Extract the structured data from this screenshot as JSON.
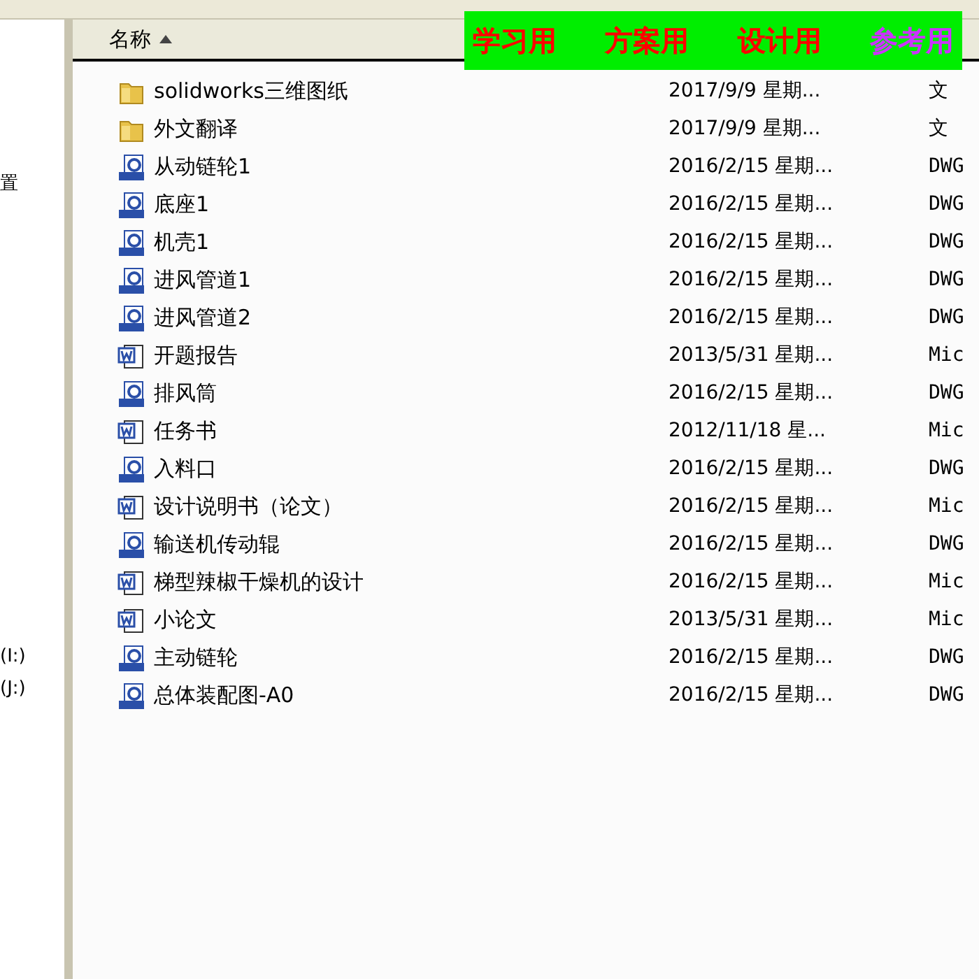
{
  "sidebar": {
    "items": [
      {
        "label": "置"
      },
      {
        "label": "(I:)"
      },
      {
        "label": "(J:)"
      }
    ]
  },
  "table": {
    "columns": [
      {
        "label": "名称",
        "sorted": true
      }
    ],
    "rows": [
      {
        "kind": "folder",
        "name": "solidworks三维图纸",
        "date": "2017/9/9 星期...",
        "type": "文"
      },
      {
        "kind": "folder",
        "name": "外文翻译",
        "date": "2017/9/9 星期...",
        "type": "文"
      },
      {
        "kind": "dwg",
        "name": "从动链轮1",
        "date": "2016/2/15 星期...",
        "type": "DWG"
      },
      {
        "kind": "dwg",
        "name": "底座1",
        "date": "2016/2/15 星期...",
        "type": "DWG"
      },
      {
        "kind": "dwg",
        "name": "机壳1",
        "date": "2016/2/15 星期...",
        "type": "DWG"
      },
      {
        "kind": "dwg",
        "name": "进风管道1",
        "date": "2016/2/15 星期...",
        "type": "DWG"
      },
      {
        "kind": "dwg",
        "name": "进风管道2",
        "date": "2016/2/15 星期...",
        "type": "DWG"
      },
      {
        "kind": "doc",
        "name": "开题报告",
        "date": "2013/5/31 星期...",
        "type": "Mic"
      },
      {
        "kind": "dwg",
        "name": "排风筒",
        "date": "2016/2/15 星期...",
        "type": "DWG"
      },
      {
        "kind": "doc",
        "name": "任务书",
        "date": "2012/11/18 星...",
        "type": "Mic"
      },
      {
        "kind": "dwg",
        "name": "入料口",
        "date": "2016/2/15 星期...",
        "type": "DWG"
      },
      {
        "kind": "doc",
        "name": "设计说明书（论文）",
        "date": "2016/2/15 星期...",
        "type": "Mic"
      },
      {
        "kind": "dwg",
        "name": "输送机传动辊",
        "date": "2016/2/15 星期...",
        "type": "DWG"
      },
      {
        "kind": "doc",
        "name": "梯型辣椒干燥机的设计",
        "date": "2016/2/15 星期...",
        "type": "Mic"
      },
      {
        "kind": "doc",
        "name": "小论文",
        "date": "2013/5/31 星期...",
        "type": "Mic"
      },
      {
        "kind": "dwg",
        "name": "主动链轮",
        "date": "2016/2/15 星期...",
        "type": "DWG"
      },
      {
        "kind": "dwg",
        "name": "总体装配图-A0",
        "date": "2016/2/15 星期...",
        "type": "DWG"
      }
    ]
  },
  "banner": {
    "items": [
      {
        "label": "学习用",
        "color": "#ff0000"
      },
      {
        "label": "方案用",
        "color": "#ff0000"
      },
      {
        "label": "设计用",
        "color": "#ff0000"
      },
      {
        "label": "参考用",
        "color": "#cc33ff"
      }
    ]
  }
}
